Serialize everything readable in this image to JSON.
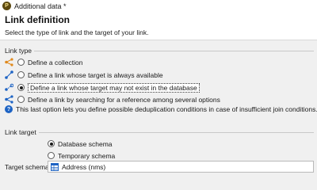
{
  "window": {
    "icon_letter": "P",
    "title": "Additional data *"
  },
  "header": {
    "title": "Link definition",
    "subtitle": "Select the type of link and the target of your link."
  },
  "link_type": {
    "group_label": "Link type",
    "options": [
      {
        "label": "Define a collection",
        "checked": false,
        "icon": "collection-link-icon"
      },
      {
        "label": "Define a link whose target is always available",
        "checked": false,
        "icon": "simple-link-icon"
      },
      {
        "label": "Define a link whose target may not exist in the database",
        "checked": true,
        "icon": "optional-link-icon"
      },
      {
        "label": "Define a link by searching for a reference among several options",
        "checked": false,
        "icon": "reconciliation-link-icon"
      }
    ],
    "info_text": "This last option lets you define possible deduplication conditions in case of insufficient join conditions."
  },
  "link_target": {
    "group_label": "Link target",
    "options": [
      {
        "label": "Database schema",
        "checked": true
      },
      {
        "label": "Temporary schema",
        "checked": false
      }
    ],
    "schema_label": "Target schema:",
    "schema_value": "Address (nms)"
  },
  "colors": {
    "icon_orange": "#e08a1e",
    "icon_blue": "#1d63c4"
  }
}
